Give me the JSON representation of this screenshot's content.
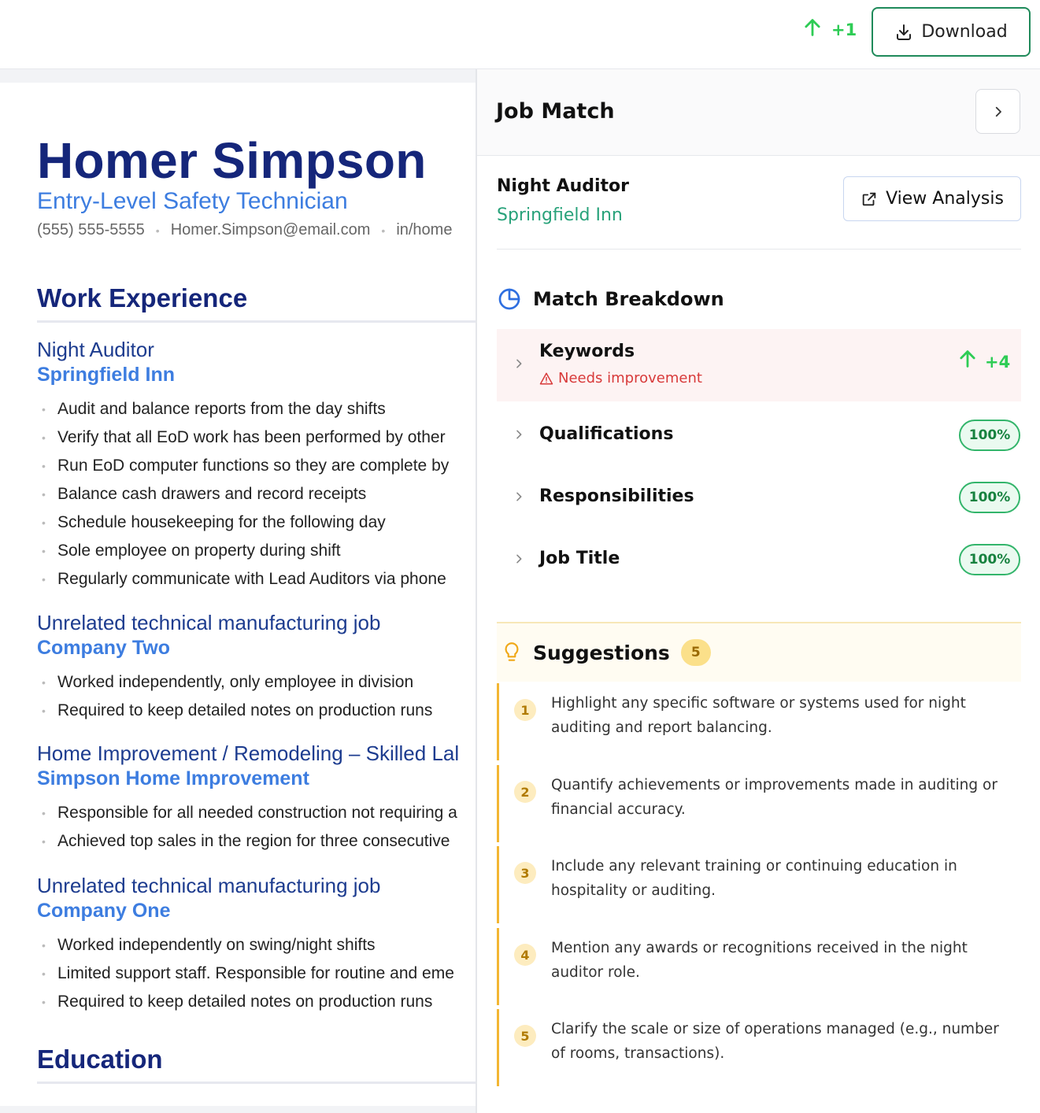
{
  "topbar": {
    "score_delta": "+1",
    "download_label": "Download",
    "colors": {
      "accent_green": "#2ecc55",
      "download_border": "#1f8a5a"
    }
  },
  "resume": {
    "name": "Homer Simpson",
    "title": "Entry-Level Safety Technician",
    "contact": {
      "phone": "(555) 555-5555",
      "email": "Homer.Simpson@email.com",
      "linkedin": "in/home"
    },
    "work_heading": "Work Experience",
    "education_heading": "Education",
    "jobs": [
      {
        "title": "Night Auditor",
        "company": "Springfield Inn",
        "bullets": [
          "Audit and balance reports from the day shifts",
          "Verify that all EoD work has been performed by other",
          "Run EoD computer functions so they are complete by",
          "Balance cash drawers and record receipts",
          "Schedule housekeeping for the following day",
          "Sole employee on property during shift",
          "Regularly communicate with Lead Auditors via phone"
        ]
      },
      {
        "title": "Unrelated technical manufacturing job",
        "company": "Company Two",
        "bullets": [
          "Worked independently, only employee in division",
          "Required to keep detailed notes on production runs"
        ]
      },
      {
        "title": "Home Improvement / Remodeling – Skilled Lal",
        "company": "Simpson Home Improvement",
        "bullets": [
          "Responsible for all needed construction not requiring a",
          "Achieved top sales in the region for three consecutive"
        ]
      },
      {
        "title": "Unrelated technical manufacturing job",
        "company": "Company One",
        "bullets": [
          "Worked independently on swing/night shifts",
          "Limited support staff. Responsible for routine and eme",
          "Required to keep detailed notes on production runs"
        ]
      }
    ]
  },
  "panel": {
    "title": "Job Match",
    "job_role": "Night Auditor",
    "job_company": "Springfield Inn",
    "view_analysis_label": "View Analysis",
    "breakdown_heading": "Match Breakdown",
    "breakdown": [
      {
        "label": "Keywords",
        "status": "Needs improvement",
        "delta": "+4"
      },
      {
        "label": "Qualifications",
        "percent": "100%"
      },
      {
        "label": "Responsibilities",
        "percent": "100%"
      },
      {
        "label": "Job Title",
        "percent": "100%"
      }
    ],
    "suggestions_heading": "Suggestions",
    "suggestions_count": "5",
    "suggestions": [
      {
        "n": "1",
        "text": "Highlight any specific software or systems used for night auditing and report balancing."
      },
      {
        "n": "2",
        "text": "Quantify achievements or improvements made in auditing or financial accuracy."
      },
      {
        "n": "3",
        "text": "Include any relevant training or continuing education in hospitality or auditing."
      },
      {
        "n": "4",
        "text": "Mention any awards or recognitions received in the night auditor role."
      },
      {
        "n": "5",
        "text": "Clarify the scale or size of operations managed (e.g., number of rooms, transactions)."
      }
    ],
    "colors": {
      "company_teal": "#28a27a",
      "warning_red": "#d83a3a",
      "badge_green": "#33b56b",
      "suggestion_amber": "#f3b632"
    }
  }
}
